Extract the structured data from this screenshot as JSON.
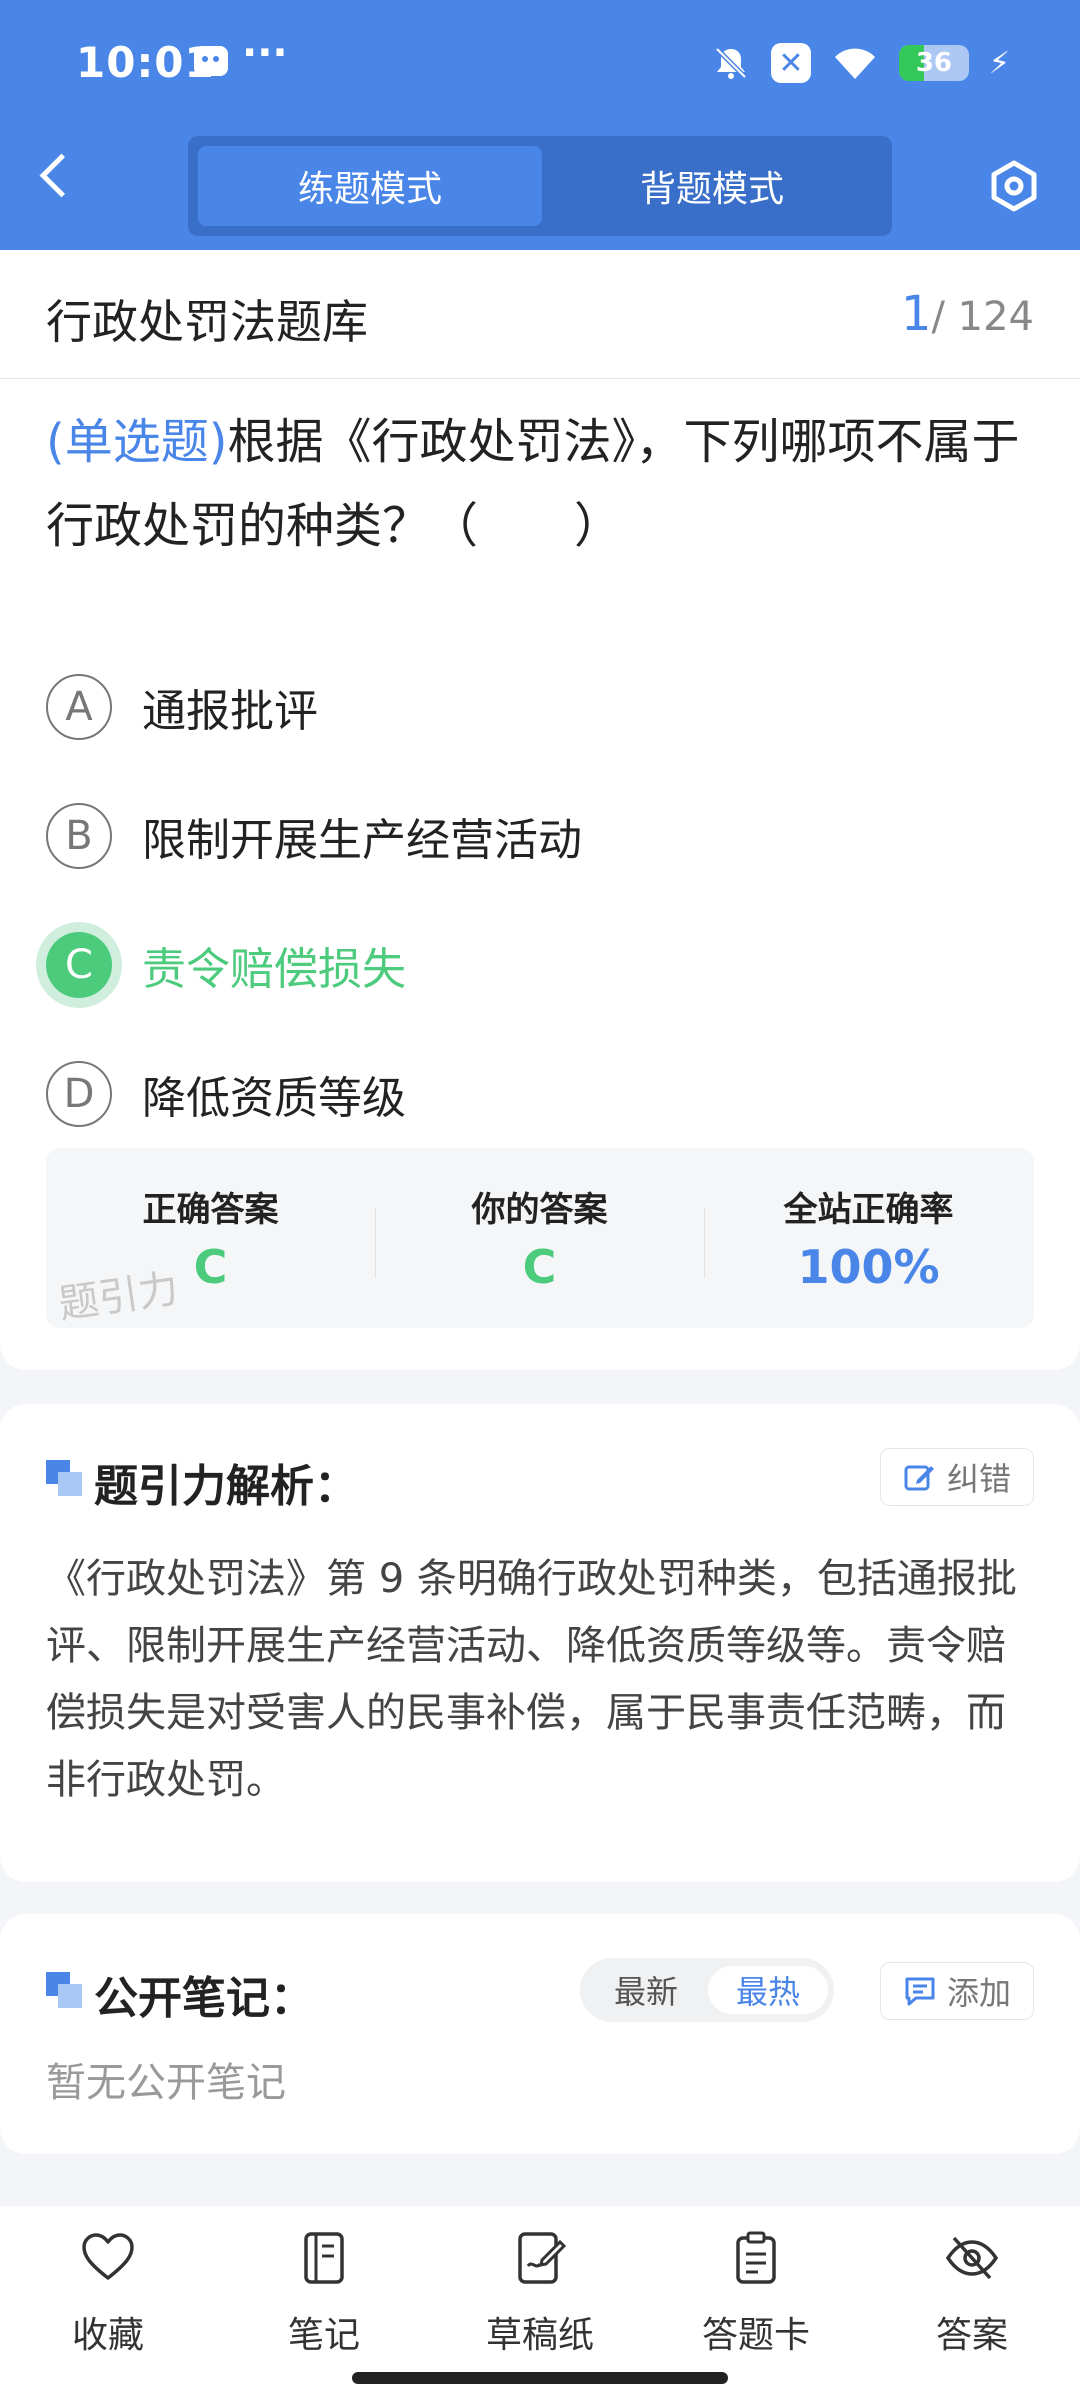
{
  "status_bar": {
    "time": "10:01",
    "more": "···",
    "battery": "36",
    "battery_level_percent": 36
  },
  "header": {
    "modes": [
      {
        "label": "练题模式",
        "active": true
      },
      {
        "label": "背题模式",
        "active": false
      }
    ]
  },
  "bank": {
    "title": "行政处罚法题库",
    "current": "1",
    "total": "/ 124"
  },
  "question": {
    "type_label": "(单选题)",
    "text": "根据《行政处罚法》，下列哪项不属于行政处罚的种类？（　　）",
    "options": [
      {
        "letter": "A",
        "text": "通报批评",
        "state": "normal"
      },
      {
        "letter": "B",
        "text": "限制开展生产经营活动",
        "state": "normal"
      },
      {
        "letter": "C",
        "text": "责令赔偿损失",
        "state": "correct"
      },
      {
        "letter": "D",
        "text": "降低资质等级",
        "state": "normal"
      }
    ]
  },
  "stats": {
    "correct_label": "正确答案",
    "correct_value": "C",
    "your_label": "你的答案",
    "your_value": "C",
    "rate_label": "全站正确率",
    "rate_value": "100%",
    "watermark": "题引力"
  },
  "analysis": {
    "title": "题引力解析：",
    "correct_btn": "纠错",
    "text": "《行政处罚法》第 9 条明确行政处罚种类，包括通报批评、限制开展生产经营活动、降低资质等级等。责令赔偿损失是对受害人的民事补偿，属于民事责任范畴，而非行政处罚。"
  },
  "notes": {
    "title": "公开笔记：",
    "sort_latest": "最新",
    "sort_hot": "最热",
    "add_btn": "添加",
    "empty": "暂无公开笔记"
  },
  "bottom_nav": [
    {
      "label": "收藏",
      "icon": "heart-icon"
    },
    {
      "label": "笔记",
      "icon": "notebook-icon"
    },
    {
      "label": "草稿纸",
      "icon": "draft-pen-icon"
    },
    {
      "label": "答题卡",
      "icon": "answer-sheet-icon"
    },
    {
      "label": "答案",
      "icon": "eye-off-icon"
    }
  ],
  "colors": {
    "primary": "#4a86e8",
    "correct": "#4ccb7d"
  }
}
